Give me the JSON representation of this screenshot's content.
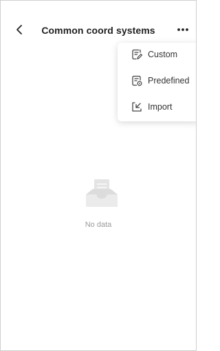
{
  "header": {
    "title": "Common coord systems",
    "back_icon": "chevron-left-icon",
    "more_icon": "more-horizontal-icon"
  },
  "menu": {
    "items": [
      {
        "label": "Custom",
        "icon": "document-edit-icon"
      },
      {
        "label": "Predefined",
        "icon": "document-settings-icon"
      },
      {
        "label": "Import",
        "icon": "import-icon"
      }
    ]
  },
  "empty_state": {
    "text": "No data",
    "icon": "empty-inbox-icon"
  },
  "colors": {
    "text": "#1f1f1f",
    "muted": "#9a9a9a",
    "background": "#ffffff"
  }
}
